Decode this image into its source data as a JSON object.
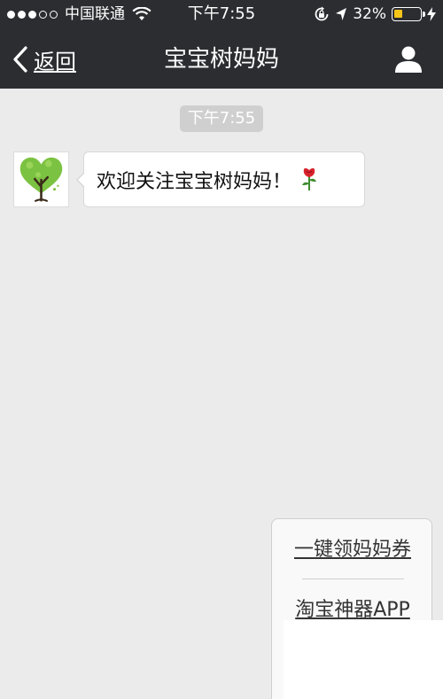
{
  "status_bar": {
    "signal_dots_filled": 3,
    "signal_dots_total": 5,
    "carrier": "中国联通",
    "time": "下午7:55",
    "battery_percent_text": "32%",
    "battery_level": 0.32,
    "icons": [
      "wifi-icon",
      "rotation-lock-icon",
      "location-arrow-icon",
      "battery-icon",
      "charging-bolt-icon"
    ]
  },
  "nav": {
    "back_label": "返回",
    "title": "宝宝树妈妈",
    "icons": [
      "chevron-left-icon",
      "person-icon"
    ]
  },
  "chat": {
    "time_label": "下午7:55",
    "message_text": "欢迎关注宝宝树妈妈！",
    "message_emoji": "rose-icon",
    "avatar_icon": "heart-tree-icon"
  },
  "menu": {
    "items": [
      "一键领妈妈券",
      "淘宝神器APP"
    ]
  },
  "colors": {
    "bar_background": "#2b2d31",
    "chat_background": "#ebebeb",
    "battery_fill": "#f5c518",
    "avatar_tree_green": "#7cc242"
  }
}
